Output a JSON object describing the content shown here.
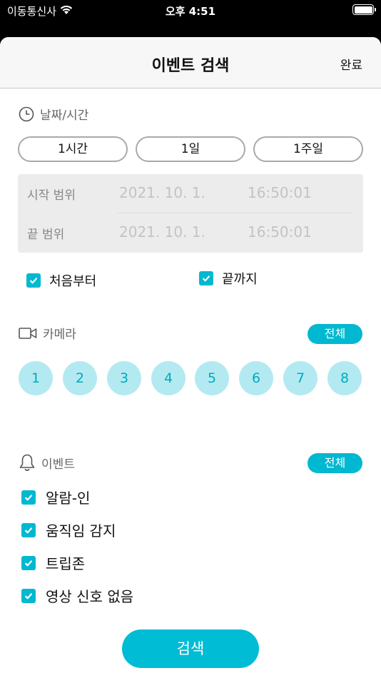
{
  "status": {
    "carrier": "이동통신사",
    "time": "오후 4:51"
  },
  "nav": {
    "title": "이벤트 검색",
    "done": "완료"
  },
  "datetime": {
    "header": "날짜/시간",
    "presets": [
      "1시간",
      "1일",
      "1주일"
    ],
    "start": {
      "label": "시작 범위",
      "date": "2021. 10. 1.",
      "time": "16:50:01"
    },
    "end": {
      "label": "끝 범위",
      "date": "2021. 10. 1.",
      "time": "16:50:01"
    },
    "from_beginning": {
      "label": "처음부터",
      "checked": true
    },
    "to_end": {
      "label": "끝까지",
      "checked": true
    }
  },
  "camera": {
    "header": "카메라",
    "all": "전체",
    "channels": [
      "1",
      "2",
      "3",
      "4",
      "5",
      "6",
      "7",
      "8"
    ]
  },
  "event": {
    "header": "이벤트",
    "all": "전체",
    "items": [
      {
        "label": "알람-인",
        "checked": true
      },
      {
        "label": "움직임 감지",
        "checked": true
      },
      {
        "label": "트립존",
        "checked": true
      },
      {
        "label": "영상 신호 없음",
        "checked": true
      }
    ]
  },
  "search_button": "검색",
  "colors": {
    "accent": "#00b8d0",
    "camera_bg": "#b3eaf1",
    "camera_fg": "#00a9c0"
  }
}
